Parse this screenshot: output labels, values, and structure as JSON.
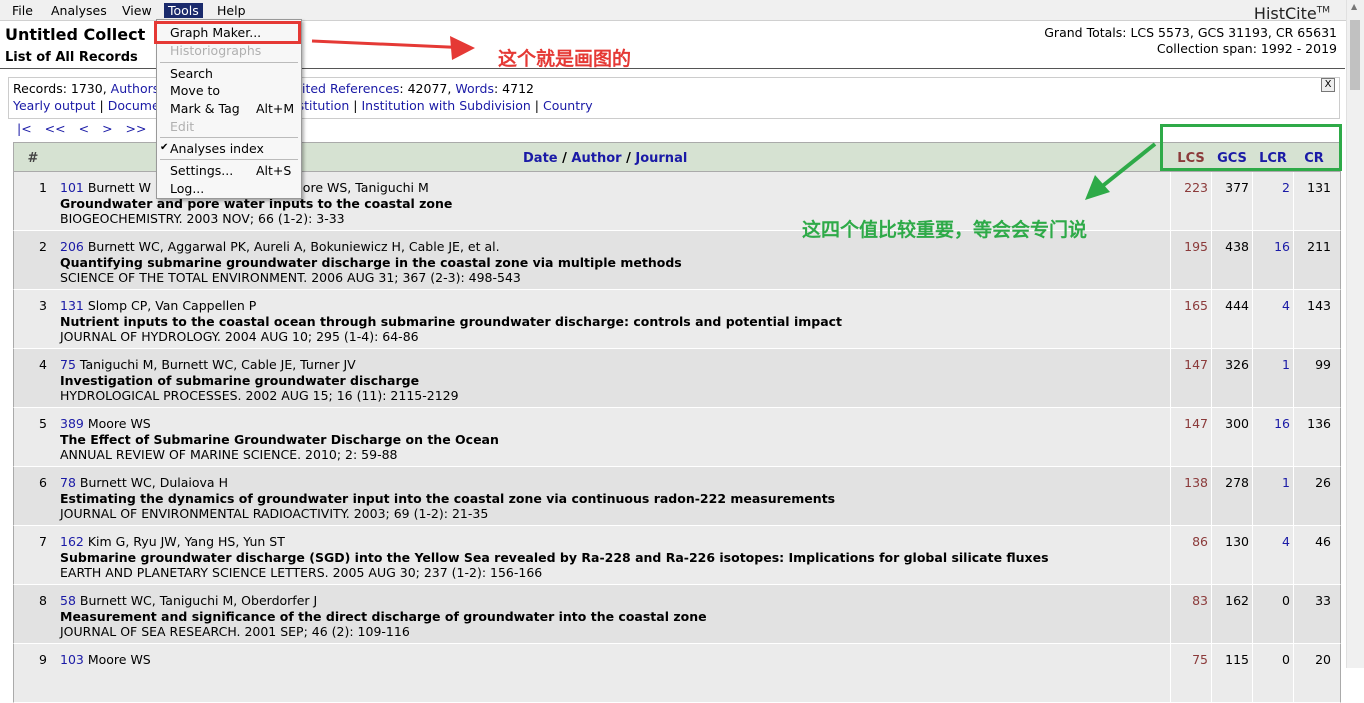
{
  "menubar": {
    "items": [
      "File",
      "Analyses",
      "View",
      "Tools",
      "Help"
    ],
    "brand": "HistCite",
    "brand_tm": "TM"
  },
  "header": {
    "title": "Untitled Collect",
    "subtitle": "List of All Records",
    "totals_line1": "Grand Totals: LCS 5573, GCS 31193, CR 65631",
    "totals_line2": "Collection span: 1992 - 2019"
  },
  "info": {
    "records": "Records: 1730, ",
    "authors": "Authors",
    "cited_refs": "Cited References",
    "cited_refs_value": ": 42077, ",
    "words": "Words",
    "words_value": ": 4712",
    "yearly_output": "Yearly output",
    "document": "Docume",
    "institution": "stitution",
    "institution_sub": "Institution with Subdivision",
    "country": "Country",
    "close": "X"
  },
  "pager": {
    "first": "|<",
    "prev_many": "<<",
    "prev": "<",
    "next": ">",
    "next_many": ">>"
  },
  "table": {
    "col_num": "#",
    "col_date": "Date",
    "col_author": "Author",
    "col_journal": "Journal",
    "sep": "/",
    "col_lcs": "LCS",
    "col_gcs": "GCS",
    "col_lcr": "LCR",
    "col_cr": "CR",
    "rows": [
      {
        "n": "1",
        "id": "101",
        "authors": "Burnett W",
        "authors_tail": "ettel M, Moore WS, Taniguchi M",
        "title": "Groundwater and pore water inputs to the coastal zone",
        "source": "BIOGEOCHEMISTRY. 2003 NOV; 66 (1-2): 3-33",
        "lcs": "223",
        "gcs": "377",
        "lcr": "2",
        "cr": "131"
      },
      {
        "n": "2",
        "id": "206",
        "authors": "Burnett WC, Aggarwal PK, Aureli A, Bokuniewicz H, Cable JE, et al.",
        "authors_tail": "",
        "title": "Quantifying submarine groundwater discharge in the coastal zone via multiple methods",
        "source": "SCIENCE OF THE TOTAL ENVIRONMENT. 2006 AUG 31; 367 (2-3): 498-543",
        "lcs": "195",
        "gcs": "438",
        "lcr": "16",
        "cr": "211"
      },
      {
        "n": "3",
        "id": "131",
        "authors": "Slomp CP, Van Cappellen P",
        "authors_tail": "",
        "title": "Nutrient inputs to the coastal ocean through submarine groundwater discharge: controls and potential impact",
        "source": "JOURNAL OF HYDROLOGY. 2004 AUG 10; 295 (1-4): 64-86",
        "lcs": "165",
        "gcs": "444",
        "lcr": "4",
        "cr": "143"
      },
      {
        "n": "4",
        "id": "75",
        "authors": "Taniguchi M, Burnett WC, Cable JE, Turner JV",
        "authors_tail": "",
        "title": "Investigation of submarine groundwater discharge",
        "source": "HYDROLOGICAL PROCESSES. 2002 AUG 15; 16 (11): 2115-2129",
        "lcs": "147",
        "gcs": "326",
        "lcr": "1",
        "cr": "99"
      },
      {
        "n": "5",
        "id": "389",
        "authors": "Moore WS",
        "authors_tail": "",
        "title": "The Effect of Submarine Groundwater Discharge on the Ocean",
        "source": "ANNUAL REVIEW OF MARINE SCIENCE. 2010; 2: 59-88",
        "lcs": "147",
        "gcs": "300",
        "lcr": "16",
        "cr": "136"
      },
      {
        "n": "6",
        "id": "78",
        "authors": "Burnett WC, Dulaiova H",
        "authors_tail": "",
        "title": "Estimating the dynamics of groundwater input into the coastal zone via continuous radon-222 measurements",
        "source": "JOURNAL OF ENVIRONMENTAL RADIOACTIVITY. 2003; 69 (1-2): 21-35",
        "lcs": "138",
        "gcs": "278",
        "lcr": "1",
        "cr": "26"
      },
      {
        "n": "7",
        "id": "162",
        "authors": "Kim G, Ryu JW, Yang HS, Yun ST",
        "authors_tail": "",
        "title": "Submarine groundwater discharge (SGD) into the Yellow Sea revealed by Ra-228 and Ra-226 isotopes: Implications for global silicate fluxes",
        "source": "EARTH AND PLANETARY SCIENCE LETTERS. 2005 AUG 30; 237 (1-2): 156-166",
        "lcs": "86",
        "gcs": "130",
        "lcr": "4",
        "cr": "46"
      },
      {
        "n": "8",
        "id": "58",
        "authors": "Burnett WC, Taniguchi M, Oberdorfer J",
        "authors_tail": "",
        "title": "Measurement and significance of the direct discharge of groundwater into the coastal zone",
        "source": "JOURNAL OF SEA RESEARCH. 2001 SEP; 46 (2): 109-116",
        "lcs": "83",
        "gcs": "162",
        "lcr": "0",
        "cr": "33"
      },
      {
        "n": "9",
        "id": "103",
        "authors": "Moore WS",
        "authors_tail": "",
        "title": "",
        "source": "",
        "lcs": "75",
        "gcs": "115",
        "lcr": "0",
        "cr": "20"
      }
    ]
  },
  "tools_menu": {
    "graph_maker": "Graph Maker...",
    "historiographs": "Historiographs",
    "search": "Search",
    "move_to": "Move to",
    "mark_tag": "Mark & Tag",
    "mark_tag_shortcut": "Alt+M",
    "edit": "Edit",
    "analyses_index": "Analyses index",
    "settings": "Settings...",
    "settings_shortcut": "Alt+S",
    "log": "Log..."
  },
  "annotations": {
    "red_note": "这个就是画图的",
    "green_note": "这四个值比较重要，等会会专门说",
    "red_color": "#e53935",
    "green_color": "#2eaa48"
  }
}
